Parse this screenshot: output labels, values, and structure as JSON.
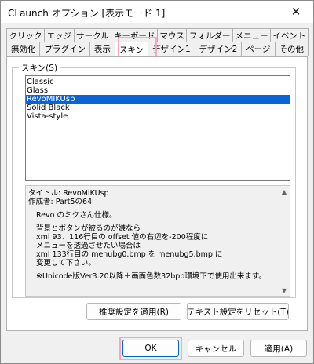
{
  "window": {
    "title": "CLaunch オプション [表示モード 1]",
    "close_symbol": "✕"
  },
  "tabs": {
    "row1": [
      "クリック",
      "エッジ",
      "サークル",
      "キーボード",
      "マウス",
      "フォルダー",
      "メニュー",
      "イベント"
    ],
    "row2": [
      "無効化",
      "プラグイン",
      "表示",
      "スキン",
      "デザイン1",
      "デザイン2",
      "ページ",
      "その他"
    ],
    "active": "スキン"
  },
  "skin_group": {
    "label": "スキン(S)",
    "items": [
      "Classic",
      "Glass",
      "RevoMIKUsp",
      "Solid Black",
      "Vista-style"
    ],
    "selected": "RevoMIKUsp"
  },
  "info": {
    "title_line": "タイトル: RevoMIKUsp",
    "author_line": "作成者: Part5の64",
    "desc_line": "Revo のミクさん仕様。",
    "note_lines": [
      "背景とボタンが被るのが嫌なら",
      "xml 93、116行目の offset 値の右辺を-200程度に",
      "メニューを透過させたい場合は",
      "xml 133行目の menubg0.bmp を menubg5.bmp に",
      "変更して下さい。"
    ],
    "req_line": "※Unicode版Ver3.20以降＋画面色数32bpp環境下で使用出来ます。",
    "scroll_up": "▲",
    "scroll_down": "▼"
  },
  "buttons": {
    "apply_recommended": "推奨設定を適用(R)",
    "reset_text": "テキスト設定をリセット(T)",
    "ok": "OK",
    "cancel": "キャンセル",
    "apply": "適用(A)"
  },
  "colors": {
    "selection": "#0a64d6",
    "highlight": "#f2a6c8",
    "primary_border": "#0067c0"
  }
}
